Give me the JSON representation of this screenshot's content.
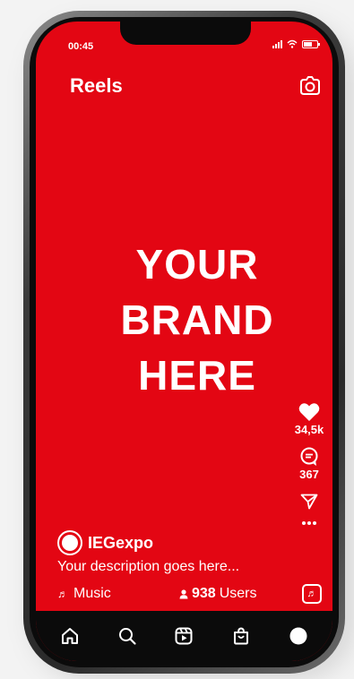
{
  "status": {
    "time": "00:45"
  },
  "header": {
    "title": "Reels"
  },
  "content": {
    "brand_lines": [
      "YOUR",
      "BRAND",
      "HERE"
    ]
  },
  "actions": {
    "likes": "34,5k",
    "comments": "367"
  },
  "post": {
    "handle": "IEGexpo",
    "description": "Your description goes here...",
    "music_label": "Music",
    "users_count": "938",
    "users_label": "Users"
  },
  "colors": {
    "accent": "#e30613",
    "navbar": "#0b0b0b",
    "text": "#ffffff"
  },
  "icons": {
    "header": "camera-icon",
    "rail": [
      "heart-icon",
      "comment-icon",
      "send-icon",
      "more-icon",
      "music-tile-icon"
    ],
    "nav": [
      "home-icon",
      "search-icon",
      "reels-icon",
      "shop-icon",
      "profile-icon"
    ]
  }
}
